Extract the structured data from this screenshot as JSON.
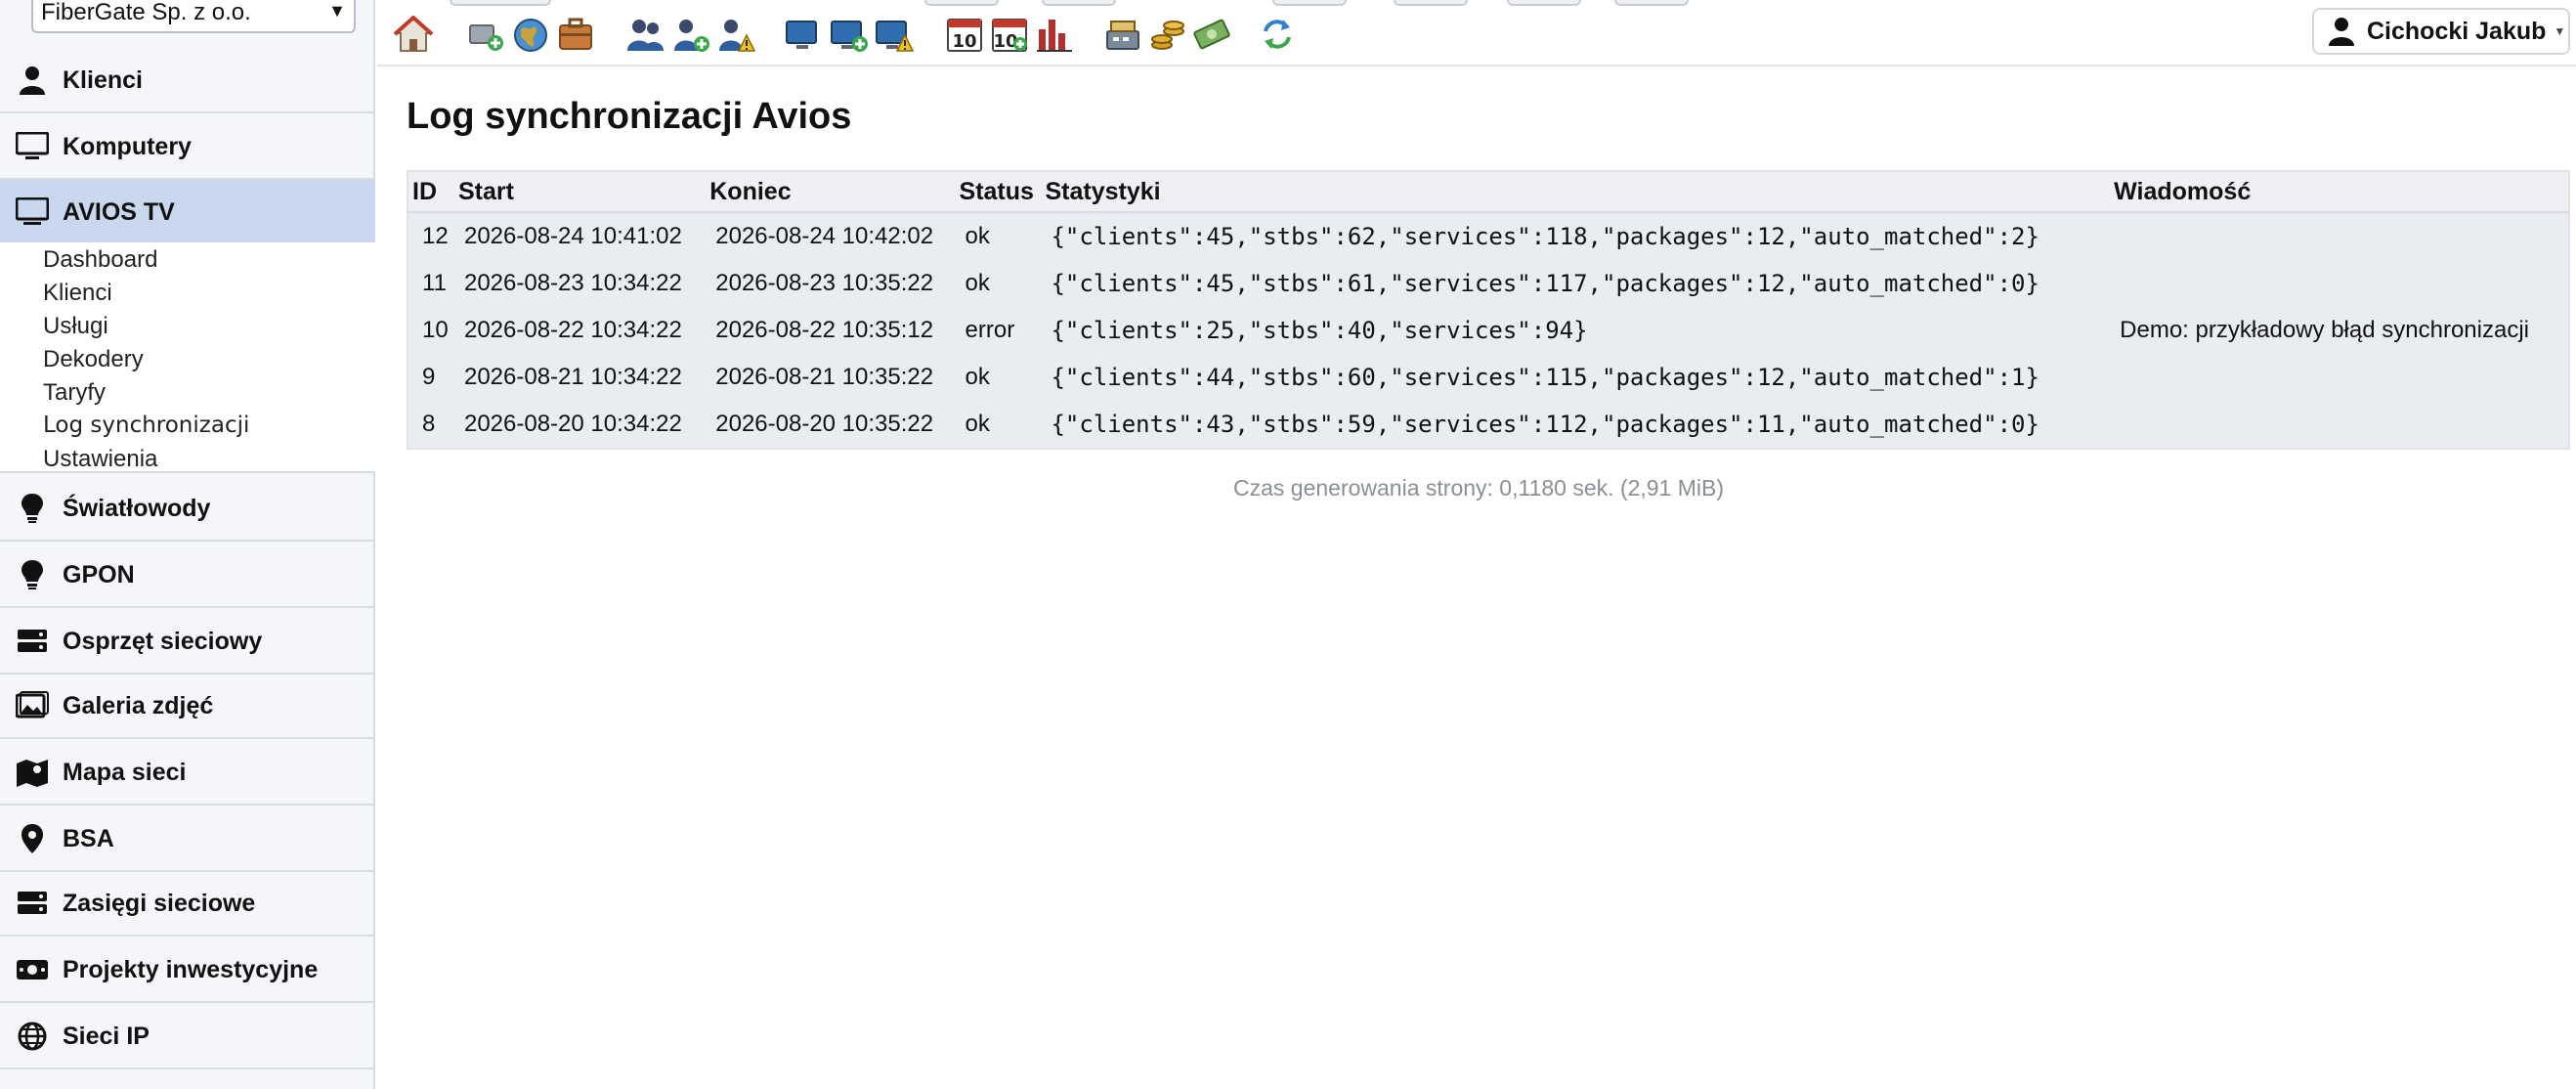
{
  "company": "FiberGate Sp. z o.o.",
  "user": "Cichocki Jakub",
  "nav": {
    "klienci": "Klienci",
    "komputery": "Komputery",
    "avios": "AVIOS TV",
    "swiatlowody": "Światłowody",
    "gpon": "GPON",
    "osprzet": "Osprzęt sieciowy",
    "galeria": "Galeria zdjęć",
    "mapa": "Mapa sieci",
    "bsa": "BSA",
    "zasiegi": "Zasięgi sieciowe",
    "projekty": "Projekty inwestycyjne",
    "sieci": "Sieci IP"
  },
  "subnav": {
    "dashboard": "Dashboard",
    "klienci": "Klienci",
    "uslugi": "Usługi",
    "dekodery": "Dekodery",
    "taryfy": "Taryfy",
    "log": "Log synchronizacji",
    "ustawienia": "Ustawienia"
  },
  "page": {
    "title": "Log synchronizacji Avios",
    "footer": "Czas generowania strony: 0,1180 sek. (2,91 MiB)"
  },
  "table": {
    "headers": {
      "id": "ID",
      "start": "Start",
      "end": "Koniec",
      "status": "Status",
      "stats": "Statystyki",
      "message": "Wiadomość"
    },
    "rows": [
      {
        "id": "12",
        "start": "2026-08-24 10:41:02",
        "end": "2026-08-24 10:42:02",
        "status": "ok",
        "stats": "{\"clients\":45,\"stbs\":62,\"services\":118,\"packages\":12,\"auto_matched\":2}",
        "message": ""
      },
      {
        "id": "11",
        "start": "2026-08-23 10:34:22",
        "end": "2026-08-23 10:35:22",
        "status": "ok",
        "stats": "{\"clients\":45,\"stbs\":61,\"services\":117,\"packages\":12,\"auto_matched\":0}",
        "message": ""
      },
      {
        "id": "10",
        "start": "2026-08-22 10:34:22",
        "end": "2026-08-22 10:35:12",
        "status": "error",
        "stats": "{\"clients\":25,\"stbs\":40,\"services\":94}",
        "message": "Demo: przykładowy błąd synchronizacji"
      },
      {
        "id": "9",
        "start": "2026-08-21 10:34:22",
        "end": "2026-08-21 10:35:22",
        "status": "ok",
        "stats": "{\"clients\":44,\"stbs\":60,\"services\":115,\"packages\":12,\"auto_matched\":1}",
        "message": ""
      },
      {
        "id": "8",
        "start": "2026-08-20 10:34:22",
        "end": "2026-08-20 10:35:22",
        "status": "ok",
        "stats": "{\"clients\":43,\"stbs\":59,\"services\":112,\"packages\":11,\"auto_matched\":0}",
        "message": ""
      }
    ]
  },
  "toolbar_icons": [
    "home-icon",
    "add-network-icon",
    "globe-icon",
    "briefcase-icon",
    "users-icon",
    "add-user-icon",
    "user-warning-icon",
    "computer-icon",
    "add-computer-icon",
    "computer-warning-icon",
    "calendar-icon",
    "add-calendar-icon",
    "chart-icon",
    "cash-register-icon",
    "coins-icon",
    "money-icon",
    "sync-icon"
  ]
}
